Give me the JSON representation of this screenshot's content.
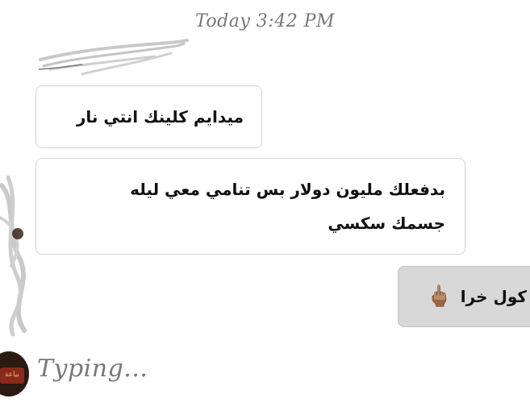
{
  "chat": {
    "timestamp": "Today 3:42 PM",
    "messages": [
      {
        "direction": "incoming",
        "text": "ميدايم كلينك انتي نار"
      },
      {
        "direction": "incoming",
        "lines": [
          "بدفعلك مليون دولار بس تنامي معي ليله",
          "جسمك سكسي"
        ]
      },
      {
        "direction": "outgoing",
        "text": "كول خرا",
        "emoji": "🖕🏽",
        "emoji_name": "middle-finger-emoji"
      }
    ],
    "typing_indicator": "Typing...",
    "typing_avatar_text": "بياعة"
  },
  "colors": {
    "background": "#ffffff",
    "incoming_bubble": "#ffffff",
    "incoming_border": "#d4d4d4",
    "outgoing_bubble": "#d8d8d8",
    "meta_text": "#777777",
    "scribble": "#c9c9c9"
  }
}
